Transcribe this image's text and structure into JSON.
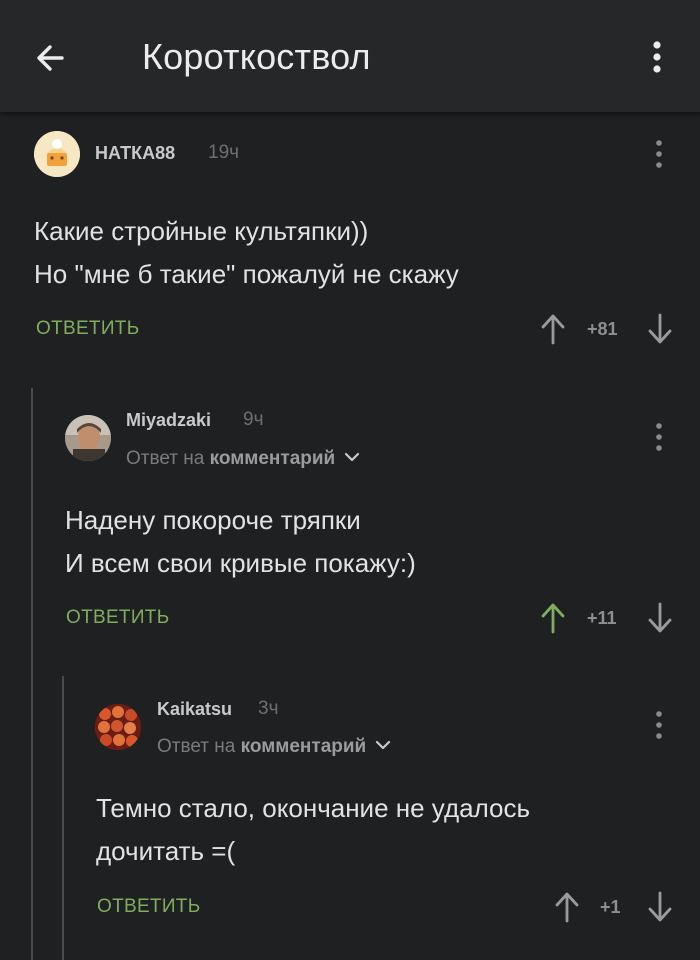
{
  "appbar": {
    "title": "Короткоствол"
  },
  "comments": [
    {
      "username": "НАТКА88",
      "time": "19ч",
      "lines": [
        "Какие стройные культяпки))",
        "Но \"мне б такие\" пожалуй не скажу"
      ],
      "reply_label": "ОТВЕТИТЬ",
      "rating": "+81"
    },
    {
      "username": "Miyadzaki",
      "time": "9ч",
      "reply_prefix": "Ответ на",
      "reply_target": "комментарий",
      "lines": [
        "Надену покороче тряпки",
        "И всем свои кривые покажу:)"
      ],
      "reply_label": "ОТВЕТИТЬ",
      "rating": "+11",
      "upvoted": true
    },
    {
      "username": "Kaikatsu",
      "time": "3ч",
      "reply_prefix": "Ответ на",
      "reply_target": "комментарий",
      "lines": [
        "Темно стало, окончание не удалось",
        "дочитать =("
      ],
      "reply_label": "ОТВЕТИТЬ",
      "rating": "+1"
    }
  ],
  "colors": {
    "background": "#1f2022",
    "appbar": "#262729",
    "accent": "#7fae5e",
    "upvote_active": "#7fae5e",
    "vote": "#9a9b9e"
  },
  "icons": {
    "back": "arrow-left-icon",
    "menu": "more-vertical-icon",
    "up": "arrow-up-icon",
    "down": "arrow-down-icon",
    "expand": "chevron-down-icon"
  }
}
